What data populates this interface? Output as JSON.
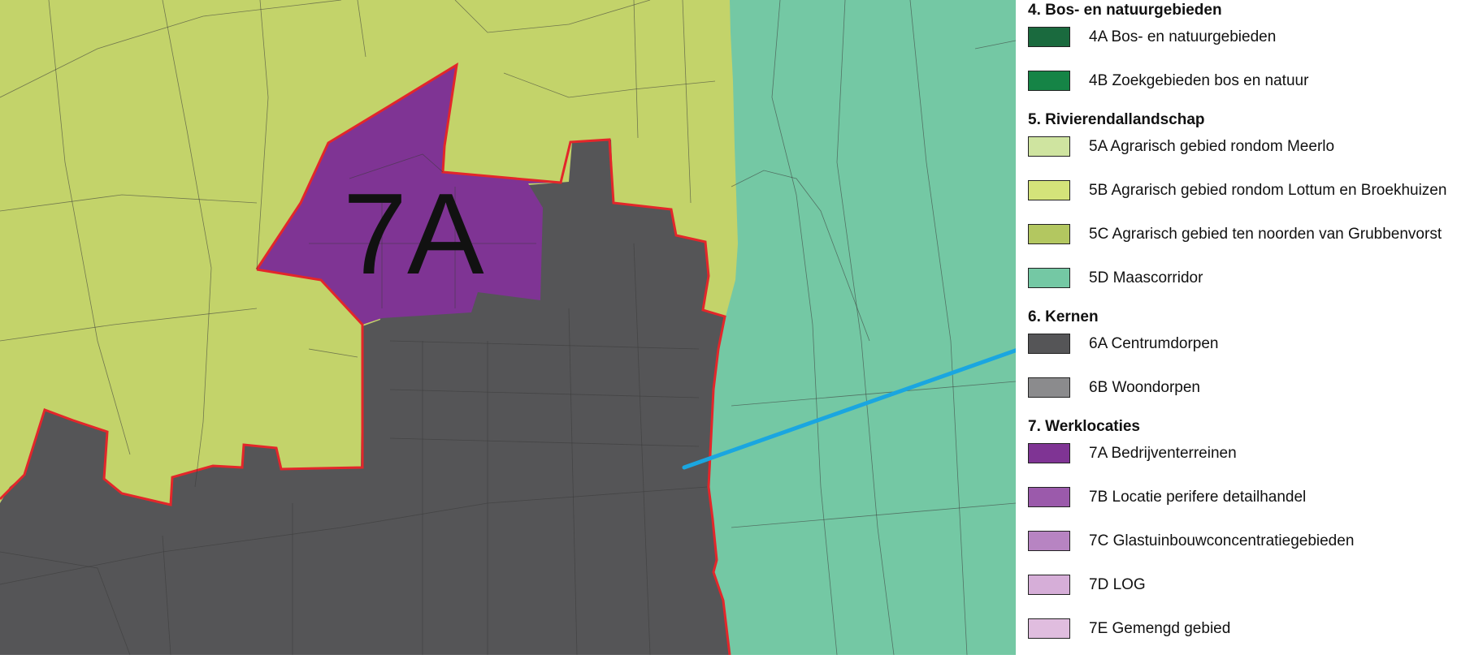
{
  "map": {
    "zone_label": "7A",
    "zones": [
      {
        "id": "agrarisch",
        "color": "#c3d36a"
      },
      {
        "id": "maascorridor",
        "color": "#74c8a4"
      },
      {
        "id": "centrumdorpen",
        "color": "#555557"
      },
      {
        "id": "bedrijventerreinen",
        "color": "#7f3494"
      }
    ],
    "boundary_color": "#e3262a",
    "pointer_color": "#1aa6e0"
  },
  "legend": {
    "sections": [
      {
        "heading": "4. Bos- en natuurgebieden",
        "items": [
          {
            "label": "4A Bos- en natuurgebieden",
            "color": "#1a6a3e"
          },
          {
            "label": "4B Zoekgebieden bos en natuur",
            "color": "#158446"
          }
        ]
      },
      {
        "heading": "5. Rivierendallandschap",
        "items": [
          {
            "label": "5A Agrarisch gebied rondom Meerlo",
            "color": "#cfe4a0"
          },
          {
            "label": "5B Agrarisch gebied rondom Lottum en Broekhuizen",
            "color": "#d4e37a"
          },
          {
            "label": "5C Agrarisch gebied ten noorden van Grubbenvorst",
            "color": "#b3c760"
          },
          {
            "label": "5D Maascorridor",
            "color": "#74c8a4"
          }
        ]
      },
      {
        "heading": "6. Kernen",
        "items": [
          {
            "label": "6A Centrumdorpen",
            "color": "#555557"
          },
          {
            "label": "6B Woondorpen",
            "color": "#8b8b8d"
          }
        ]
      },
      {
        "heading": "7. Werklocaties",
        "items": [
          {
            "label": "7A Bedrijventerreinen",
            "color": "#7f3494"
          },
          {
            "label": "7B Locatie perifere detailhandel",
            "color": "#9b5aab"
          },
          {
            "label": "7C Glastuinbouwconcentratiegebieden",
            "color": "#b784c2"
          },
          {
            "label": "7D LOG",
            "color": "#d6aed8"
          },
          {
            "label": "7E Gemengd gebied",
            "color": "#e0bddf"
          }
        ]
      }
    ]
  }
}
